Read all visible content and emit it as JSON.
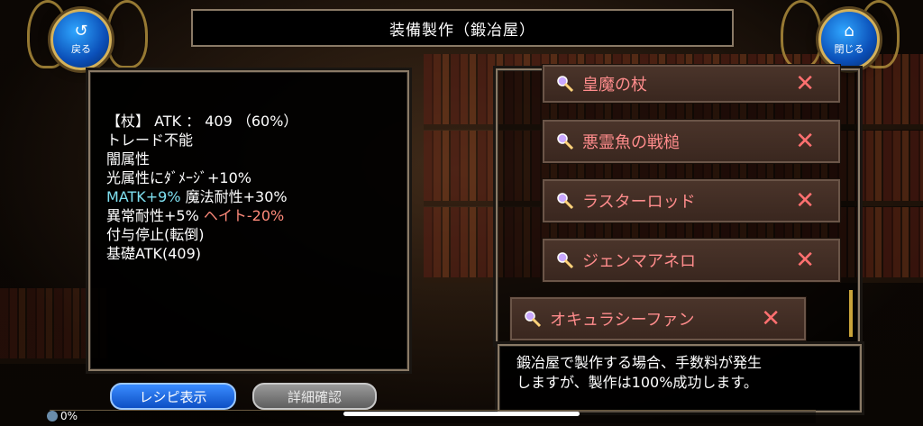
{
  "header": {
    "title": "装備製作（鍛冶屋）"
  },
  "nav": {
    "back_label": "戻る",
    "close_label": "閉じる"
  },
  "weapon_info": {
    "line1": "【杖】 ATK ： 409 （60%）",
    "line2": "トレード不能",
    "line3": "闇属性",
    "line4": "光属性にﾀﾞﾒｰｼﾞ+10%",
    "line5a": "MATK+9%",
    "line5b": " 魔法耐性+30%",
    "line6a": "異常耐性+5% ",
    "line6b": "ヘイト-20%",
    "line7": "付与停止(転倒)",
    "line8": "基礎ATK(409)"
  },
  "recipe_list": {
    "items": [
      {
        "name": "皇魔の杖",
        "mark": "✕"
      },
      {
        "name": "悪霊魚の戦槌",
        "mark": "✕"
      },
      {
        "name": "ラスターロッド",
        "mark": "✕"
      },
      {
        "name": "ジェンマアネロ",
        "mark": "✕"
      },
      {
        "name": "オキュラシーファン",
        "mark": "✕"
      }
    ]
  },
  "description": {
    "line1": "鍛冶屋で製作する場合、手数料が発生",
    "line2": "しますが、製作は100%成功します。"
  },
  "buttons": {
    "recipe": "レシピ表示",
    "details": "詳細確認"
  },
  "progress": {
    "label": "0%",
    "value": 0
  },
  "colors": {
    "accent_blue": "#1a6fe0",
    "item_text": "#ff8c8c",
    "cyan_text": "#7fe0f0",
    "gold": "#c9a33a"
  }
}
